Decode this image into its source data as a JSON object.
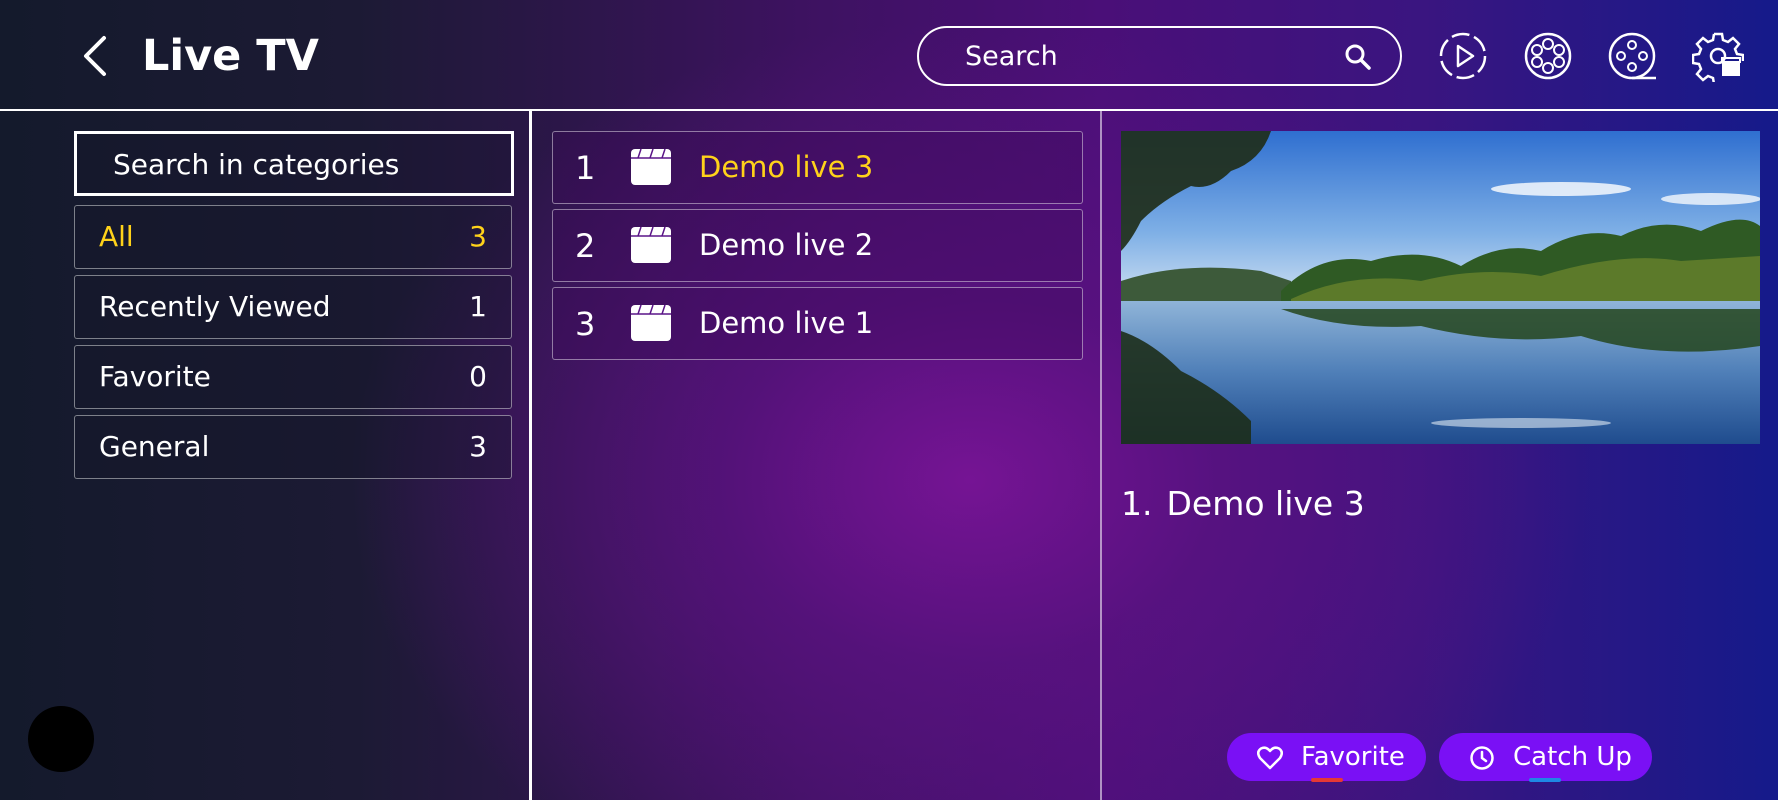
{
  "header": {
    "title": "Live TV",
    "search_placeholder": "Search",
    "icons": [
      "back-icon",
      "search-icon",
      "play-circle-icon",
      "film-reel-icon",
      "film-reel-alt-icon",
      "settings-clapper-icon"
    ]
  },
  "categories": {
    "search_placeholder": "Search in categories",
    "items": [
      {
        "label": "All",
        "count": "3",
        "active": true
      },
      {
        "label": "Recently Viewed",
        "count": "1",
        "active": false
      },
      {
        "label": "Favorite",
        "count": "0",
        "active": false
      },
      {
        "label": "General",
        "count": "3",
        "active": false
      }
    ]
  },
  "channels": [
    {
      "number": "1",
      "name": "Demo live 3",
      "active": true,
      "icon": "clapperboard-icon"
    },
    {
      "number": "2",
      "name": "Demo live 2",
      "active": false,
      "icon": "clapperboard-icon"
    },
    {
      "number": "3",
      "name": "Demo live 1",
      "active": false,
      "icon": "clapperboard-icon"
    }
  ],
  "now_playing": {
    "number": "1.",
    "title": "Demo live 3"
  },
  "actions": {
    "favorite_label": "Favorite",
    "catchup_label": "Catch Up"
  },
  "colors": {
    "accent_yellow": "#ffd21a",
    "button_purple": "#7a10f5",
    "favorite_underline": "#e53935",
    "catchup_underline": "#1e88e5"
  }
}
